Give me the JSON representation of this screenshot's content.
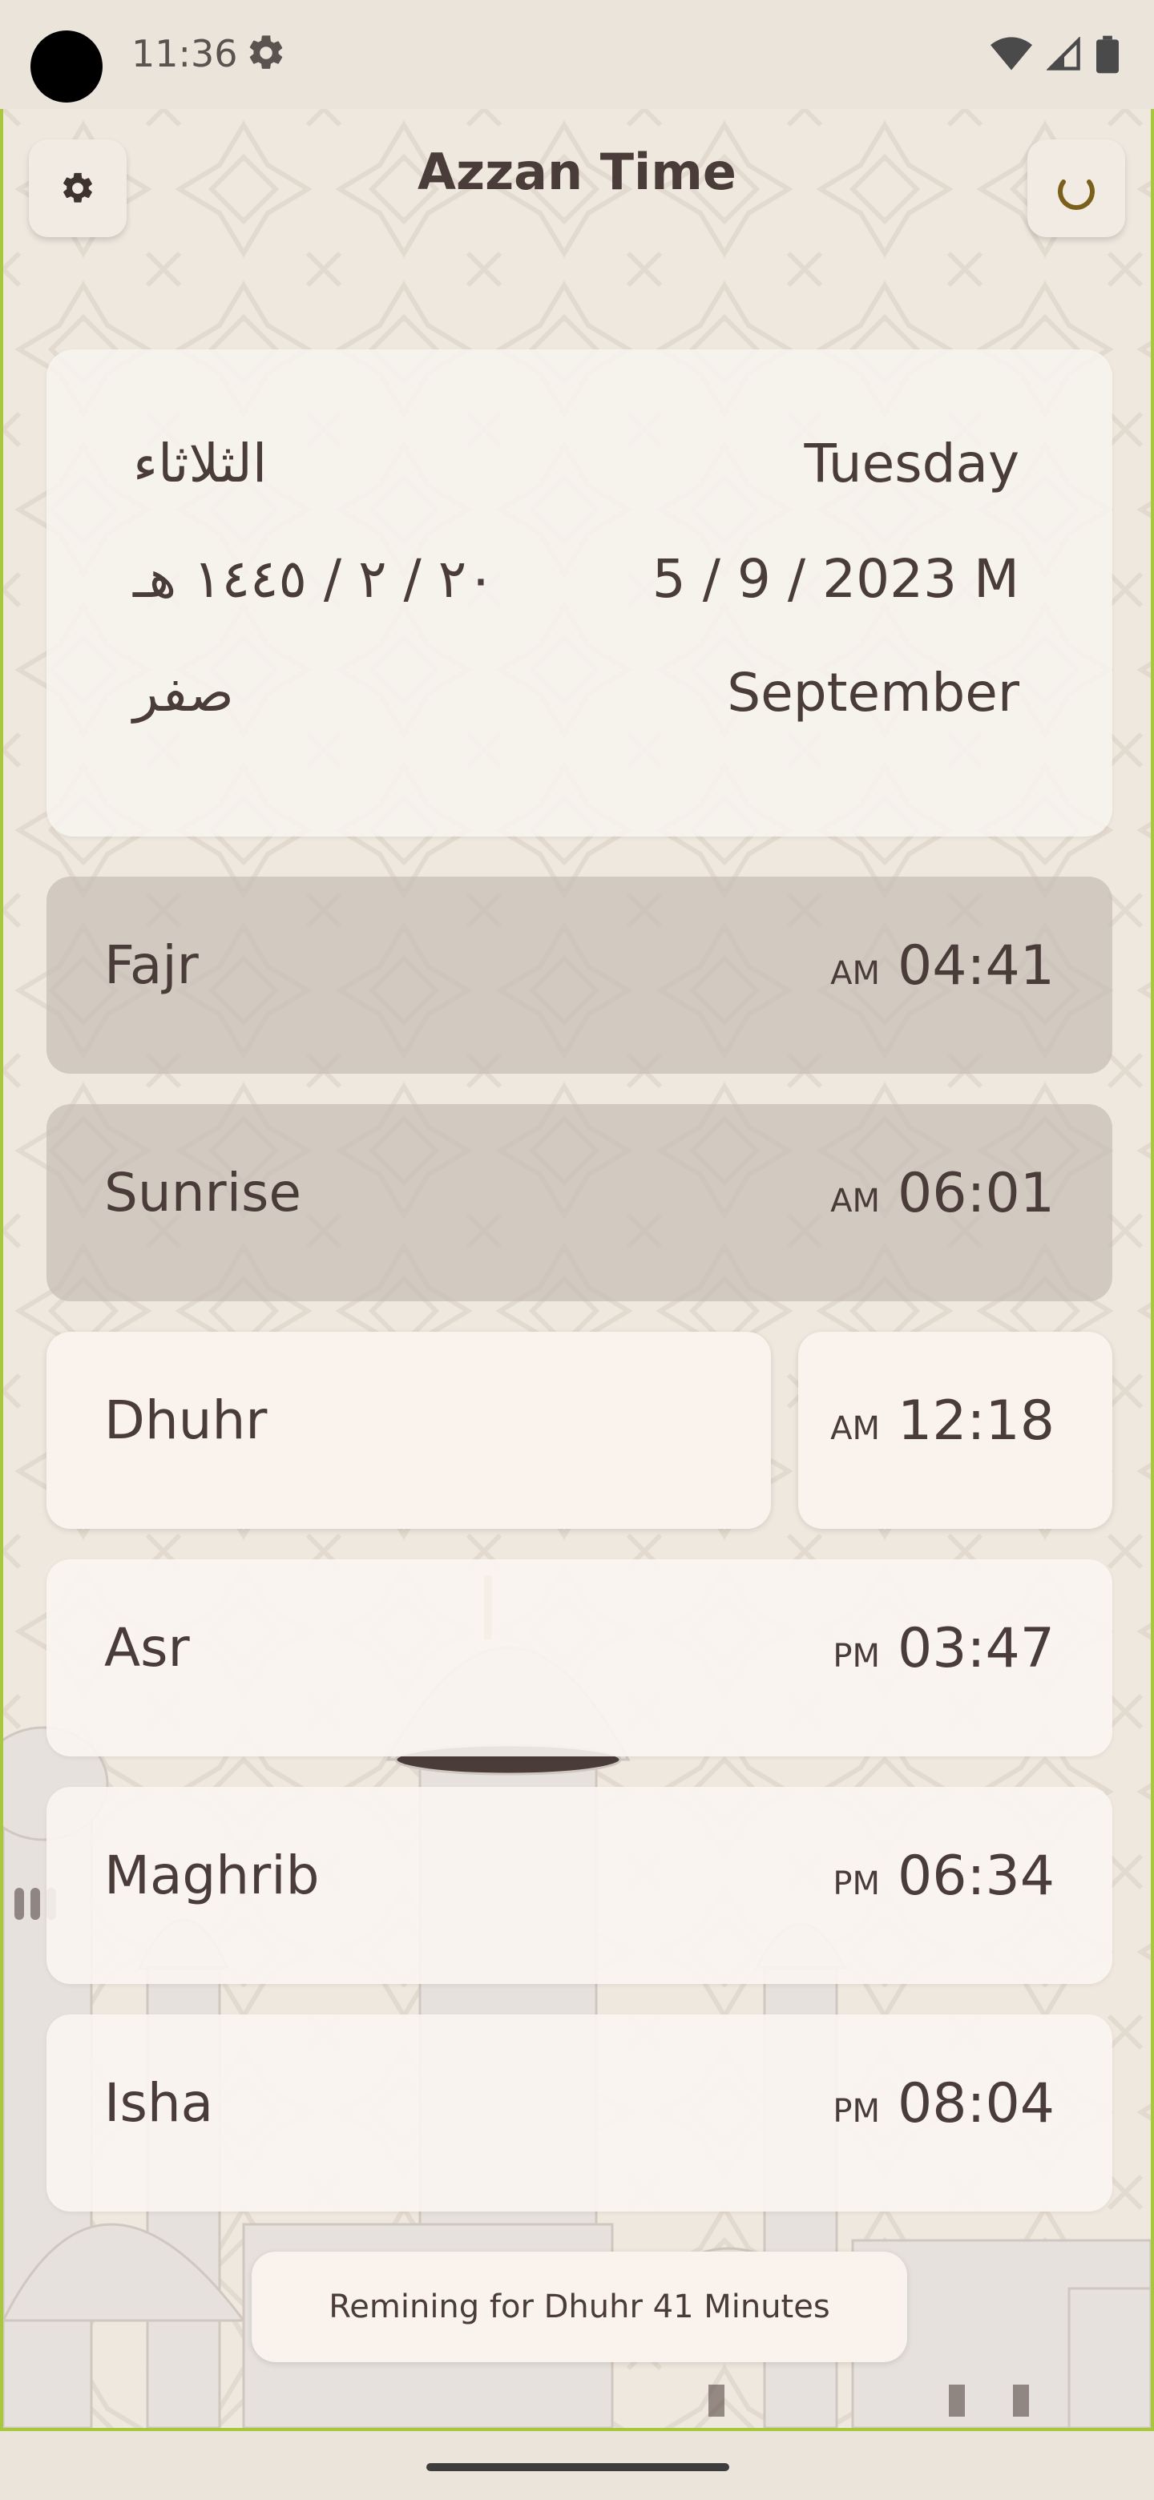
{
  "status_bar": {
    "time": "11:36"
  },
  "header": {
    "title": "Azzan Time"
  },
  "date_card": {
    "day_en": "Tuesday",
    "day_ar": "الثلاثاء",
    "gregorian": "5 / 9 / 2023 M",
    "hijri": "٢٠ / ٢ / ١٤٤٥ هـ",
    "month_en": "September",
    "month_ar": "صفر"
  },
  "prayers": [
    {
      "name": "Fajr",
      "period": "AM",
      "time": "04:41",
      "state": "past"
    },
    {
      "name": "Sunrise",
      "period": "AM",
      "time": "06:01",
      "state": "past"
    },
    {
      "name": "Dhuhr",
      "period": "AM",
      "time": "12:18",
      "state": "current"
    },
    {
      "name": "Asr",
      "period": "PM",
      "time": "03:47",
      "state": "upcoming"
    },
    {
      "name": "Maghrib",
      "period": "PM",
      "time": "06:34",
      "state": "upcoming"
    },
    {
      "name": "Isha",
      "period": "PM",
      "time": "08:04",
      "state": "upcoming"
    }
  ],
  "toast": {
    "message": "Remining for Dhuhr 41 Minutes"
  },
  "icons": {
    "settings": "gear-icon",
    "refresh": "refresh-spinner-icon",
    "status_settings": "gear-icon",
    "wifi": "wifi-icon",
    "signal": "signal-icon",
    "battery": "battery-icon"
  },
  "colors": {
    "accent": "#a7c83b",
    "text": "#4a3c38",
    "spinner": "#7a6018"
  }
}
